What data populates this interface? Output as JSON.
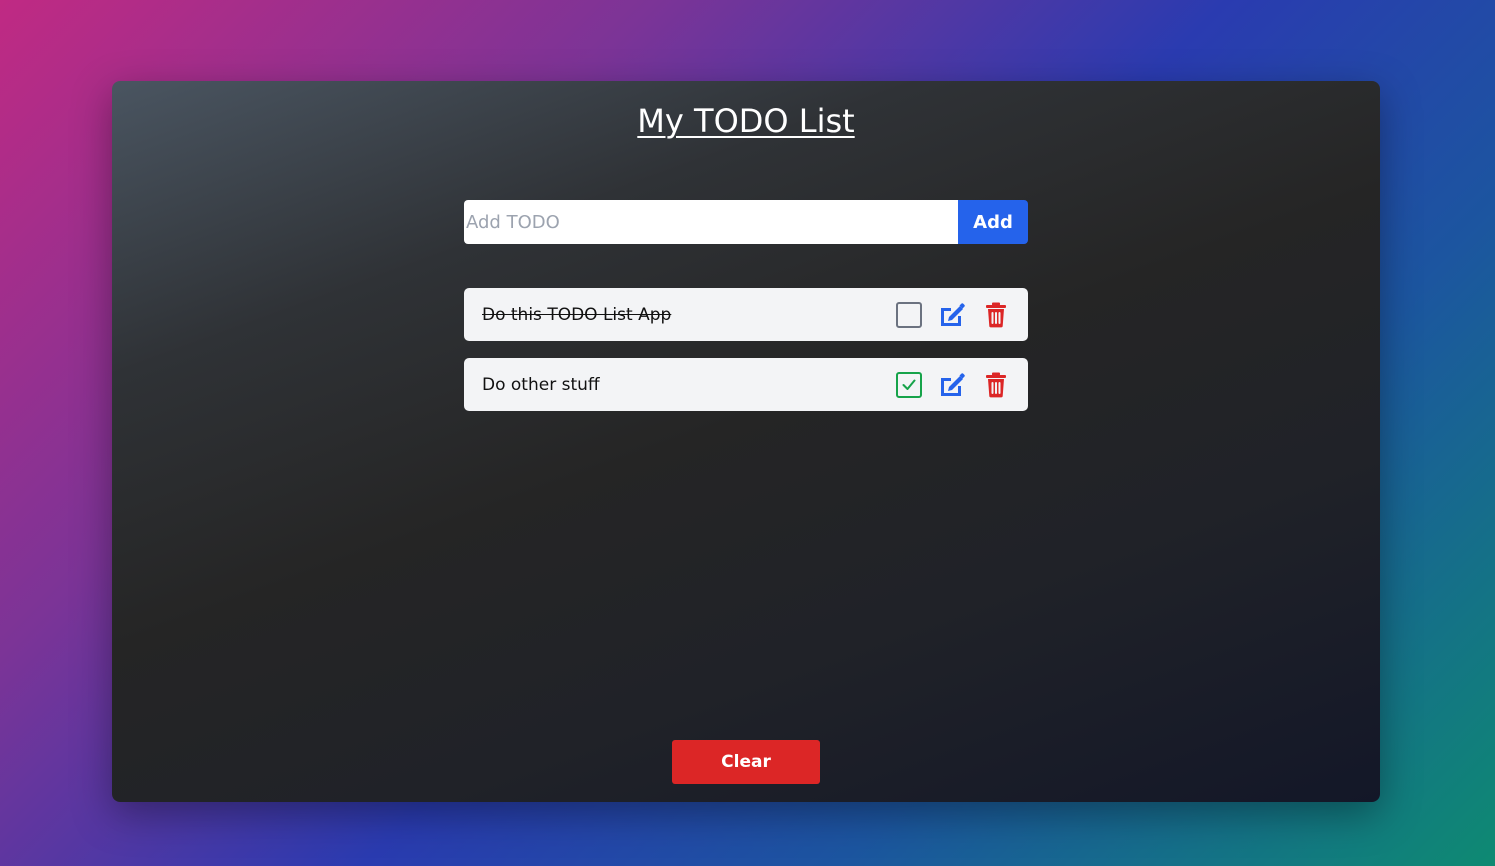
{
  "app": {
    "title": "My TODO List"
  },
  "add_form": {
    "placeholder": "Add TODO",
    "value": "",
    "button_label": "Add"
  },
  "todos": [
    {
      "text": "Do this TODO List App",
      "completed": false,
      "struck_through": true
    },
    {
      "text": "Do other stuff",
      "completed": true,
      "struck_through": false
    }
  ],
  "clear_label": "Clear",
  "icons": {
    "checkbox_empty": "checkbox-empty-icon",
    "checkbox_checked": "checkmark-icon",
    "edit": "edit-icon",
    "delete": "trash-icon"
  },
  "colors": {
    "primary": "#2563eb",
    "danger": "#dc2626",
    "success": "#16a34a",
    "item_bg": "#f3f4f6"
  }
}
